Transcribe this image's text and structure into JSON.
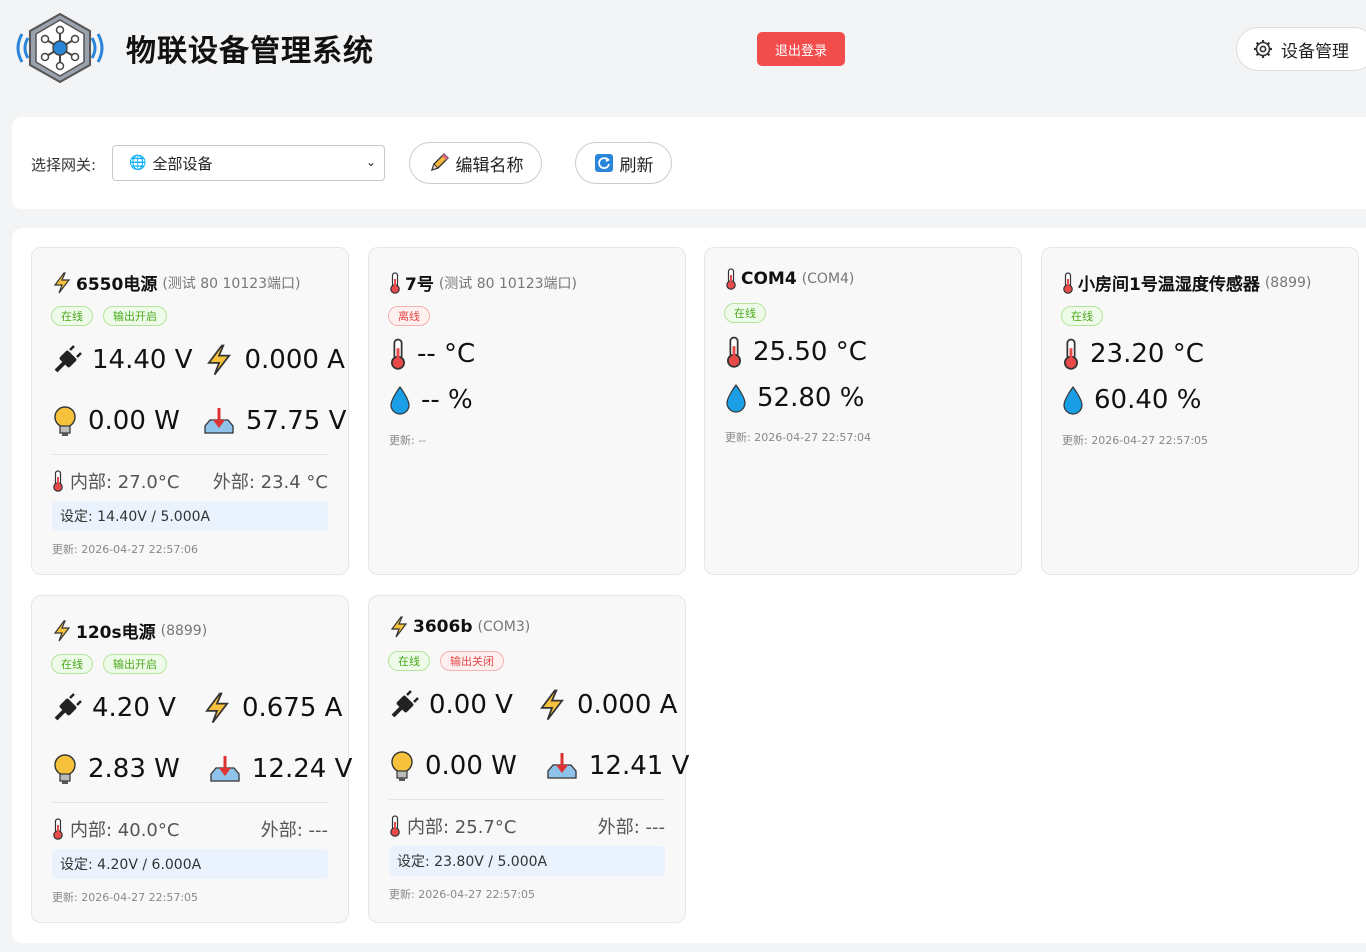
{
  "header": {
    "title": "物联设备管理系统",
    "logout_label": "退出登录",
    "device_mgmt_label": "设备管理"
  },
  "toolbar": {
    "gateway_label": "选择网关:",
    "gateway_selected": "全部设备",
    "edit_label": "编辑名称",
    "refresh_label": "刷新"
  },
  "cards": [
    {
      "kind": "power",
      "name": "6550电源",
      "sub": "(测试 80 10123端口)",
      "badges": [
        "在线",
        "输出开启"
      ],
      "voltage": "14.40 V",
      "current": "0.000 A",
      "power": "0.00 W",
      "input_voltage": "57.75 V",
      "internal": "内部: 27.0°C",
      "external": "外部: 23.4 °C",
      "setting": "设定: 14.40V / 5.000A",
      "updated": "更新: 2026-04-27 22:57:06"
    },
    {
      "kind": "sensor",
      "name": "7号",
      "sub": "(测试 80 10123端口)",
      "badges": [
        "离线"
      ],
      "temperature": "-- °C",
      "humidity": "-- %",
      "updated": "更新: --"
    },
    {
      "kind": "sensor",
      "name": "COM4",
      "sub": "(COM4)",
      "badges": [
        "在线"
      ],
      "temperature": "25.50 °C",
      "humidity": "52.80 %",
      "updated": "更新: 2026-04-27 22:57:04"
    },
    {
      "kind": "sensor",
      "name": "小房间1号温湿度传感器",
      "sub": "(8899)",
      "badges": [
        "在线"
      ],
      "temperature": "23.20 °C",
      "humidity": "60.40 %",
      "updated": "更新: 2026-04-27 22:57:05"
    },
    {
      "kind": "power",
      "name": "120s电源",
      "sub": "(8899)",
      "badges": [
        "在线",
        "输出开启"
      ],
      "voltage": "4.20 V",
      "current": "0.675 A",
      "power": "2.83 W",
      "input_voltage": "12.24 V",
      "internal": "内部: 40.0°C",
      "external": "外部: ---",
      "setting": "设定: 4.20V / 6.000A",
      "updated": "更新: 2026-04-27 22:57:05"
    },
    {
      "kind": "power",
      "name": "3606b",
      "sub": "(COM3)",
      "badges": [
        "在线",
        "输出关闭"
      ],
      "voltage": "0.00 V",
      "current": "0.000 A",
      "power": "0.00 W",
      "input_voltage": "12.41 V",
      "internal": "内部: 25.7°C",
      "external": "外部: ---",
      "setting": "设定: 23.80V / 5.000A",
      "updated": "更新: 2026-04-27 22:57:05"
    }
  ],
  "colors": {
    "online": "#4aa81f",
    "offline": "#e24848",
    "logout": "#f24d4d",
    "setting_bg": "#eaf3fd"
  }
}
